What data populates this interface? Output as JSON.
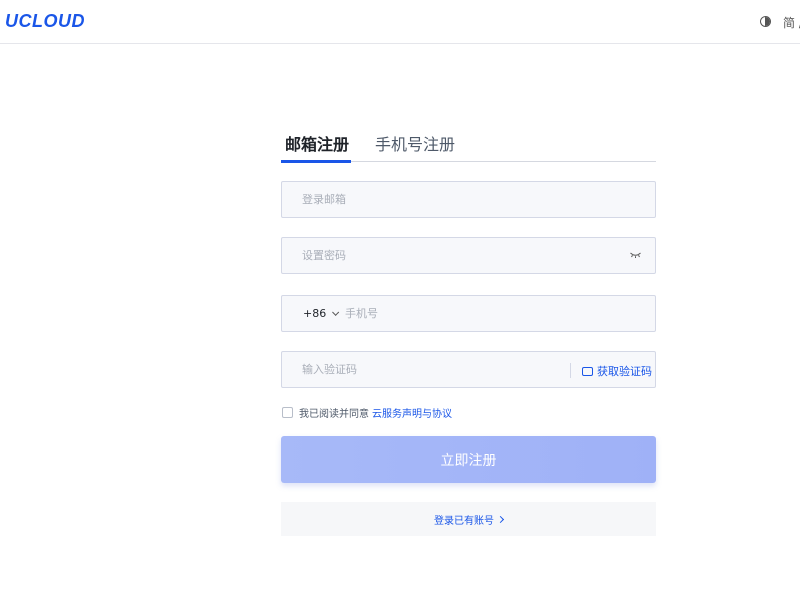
{
  "header": {
    "logo_text": "UCLOUD",
    "language_label": "简 /",
    "icons": {
      "theme": "contrast-icon"
    }
  },
  "tabs": [
    {
      "label": "邮箱注册",
      "active": true
    },
    {
      "label": "手机号注册",
      "active": false
    }
  ],
  "form": {
    "email_placeholder": "登录邮箱",
    "password_placeholder": "设置密码",
    "country_code": "+86",
    "phone_placeholder": "手机号",
    "code_placeholder": "输入验证码",
    "get_code_label": "获取验证码",
    "agree_text": "我已阅读并同意",
    "agree_link": "云服务声明与协议",
    "submit_label": "立即注册",
    "login_link": "登录已有账号"
  },
  "colors": {
    "accent": "#1a56e8",
    "submit_bg": "#a7b9f8"
  }
}
